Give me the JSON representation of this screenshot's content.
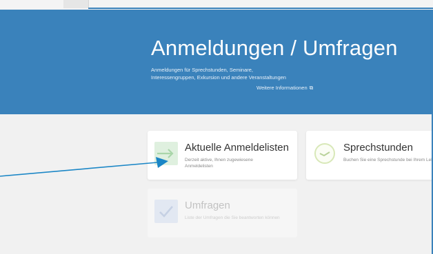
{
  "hero": {
    "title": "Anmeldungen / Umfragen",
    "subtitle_line1": "Anmeldungen für Sprechstunden, Seminare,",
    "subtitle_line2": "Interessengruppen, Exkursion und andere Veranstaltungen",
    "link_label": "Weitere Informationen"
  },
  "cards": [
    {
      "title": "Aktuelle Anmeldelisten",
      "description": "Derzeit aktive, Ihnen zugewiesene Anmeldelisten",
      "icon": "arrow-right-icon"
    },
    {
      "title": "Sprechstunden",
      "description": "Buchen Sie eine Sprechstunde bei Ihrem Lehrer",
      "icon": "clock-icon"
    },
    {
      "title": "Umfragen",
      "description": "Liste der Umfragen die Sie beantworten können",
      "icon": "checkmark-icon"
    }
  ],
  "colors": {
    "brand_blue": "#3a82bb",
    "page_bg": "#f1f1f1",
    "green_icon": "#cfe8cf",
    "annotation_arrow": "#1a86c6"
  }
}
